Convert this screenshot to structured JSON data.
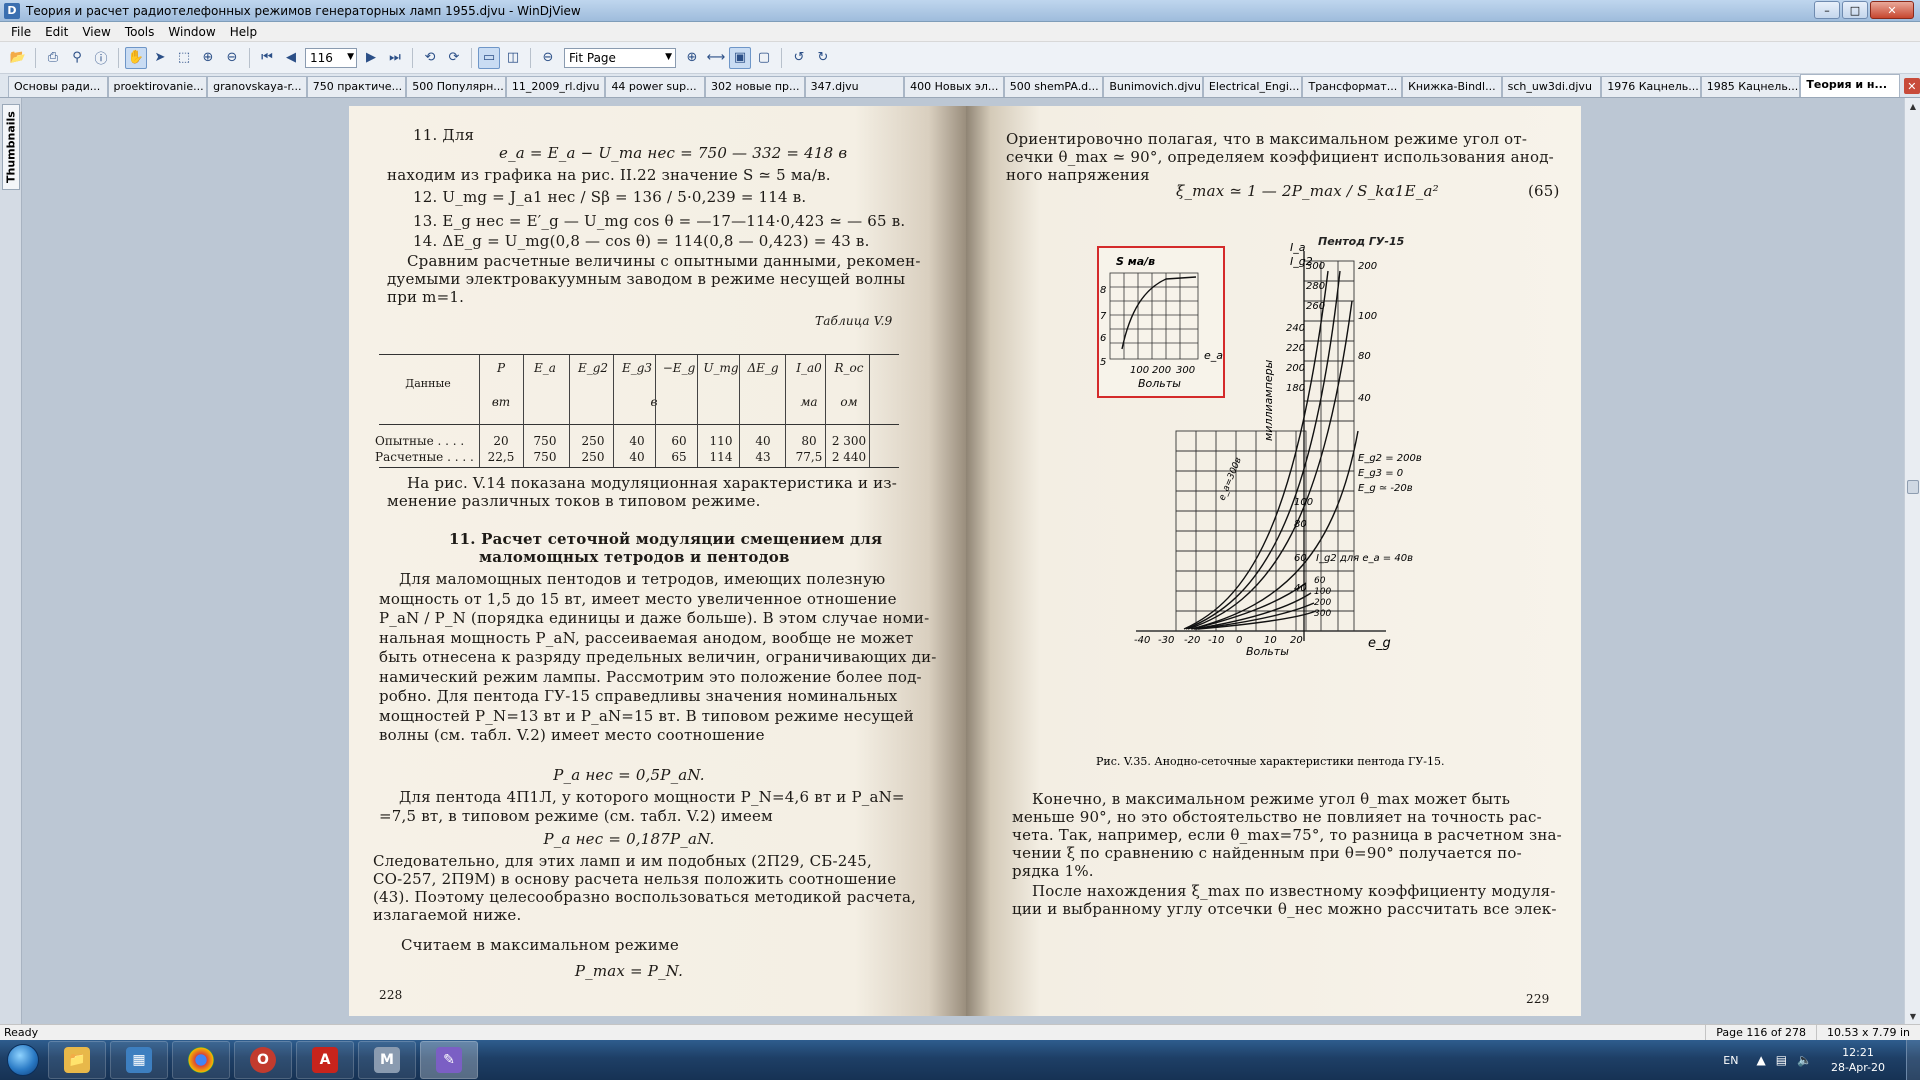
{
  "window": {
    "title": "Теория и расчет радиотелефонных режимов генераторных ламп 1955.djvu - WinDjView",
    "app_icon": "djvu-icon"
  },
  "menu": [
    "File",
    "Edit",
    "View",
    "Tools",
    "Window",
    "Help"
  ],
  "toolbar": {
    "page_number": "116",
    "zoom": "Fit Page"
  },
  "tabs": [
    {
      "label": "Основы ради..."
    },
    {
      "label": "proektirovanie..."
    },
    {
      "label": "granovskaya-r..."
    },
    {
      "label": "750 практиче..."
    },
    {
      "label": "500 Популярн..."
    },
    {
      "label": "11_2009_rl.djvu"
    },
    {
      "label": "44 power sup..."
    },
    {
      "label": "302 новые пр..."
    },
    {
      "label": "347.djvu"
    },
    {
      "label": "400 Новых эл..."
    },
    {
      "label": "500 shemPA.d..."
    },
    {
      "label": "Bunimovich.djvu"
    },
    {
      "label": "Electrical_Engi..."
    },
    {
      "label": "Трансформат..."
    },
    {
      "label": "Книжка-Bindl..."
    },
    {
      "label": "sch_uw3di.djvu"
    },
    {
      "label": "1976 Кацнель..."
    },
    {
      "label": "1985 Кацнель..."
    },
    {
      "label": "Теория и н...",
      "active": true
    }
  ],
  "sidebar": {
    "thumbnails_label": "Thumbnails"
  },
  "left_page": {
    "item11": "11. Для",
    "eq1": "e_a = E_a − U_ma нес = 750 — 332 = 418 в",
    "line_find": "находим из графика на рис. II.22 значение S ≃ 5 ма/в.",
    "item12": "12. U_mg = J_a1 нес / Sβ = 136 / 5·0,239 = 114 в.",
    "item13": "13. E_g нес = E′_g — U_mg cos θ = —17—114·0,423 ≃ — 65 в.",
    "item14": "14. ΔE_g = U_mg(0,8 — cos θ) = 114(0,8 — 0,423) = 43 в.",
    "p_compare_1": "Сравним расчетные величины с опытными данными, рекомен-",
    "p_compare_2": "дуемыми электровакуумным заводом в режиме несущей волны",
    "p_compare_3": "при m=1.",
    "table_caption": "Таблица V.9",
    "table": {
      "header_data": "Данные",
      "columns": [
        "P",
        "E_a",
        "E_g2",
        "E_g3",
        "−E_g",
        "U_mg",
        "ΔE_g",
        "I_a0",
        "R_oc"
      ],
      "units": [
        "вт",
        "в",
        "ма",
        "ом"
      ],
      "rows": [
        {
          "label": "Опытные . . . .",
          "values": [
            "20",
            "750",
            "250",
            "40",
            "60",
            "110",
            "40",
            "80",
            "2 300"
          ]
        },
        {
          "label": "Расчетные . . . .",
          "values": [
            "22,5",
            "750",
            "250",
            "40",
            "65",
            "114",
            "43",
            "77,5",
            "2 440"
          ]
        }
      ]
    },
    "p_fig_1": "На рис. V.14 показана модуляционная характеристика и из-",
    "p_fig_2": "менение различных токов в типовом режиме.",
    "section_title_1": "11. Расчет сеточной модуляции смещением для",
    "section_title_2": "маломощных тетродов и пентодов",
    "p1": [
      "Для маломощных пентодов и тетродов, имеющих полезную",
      "мощность от 1,5 до 15 вт, имеет место увеличенное отношение",
      "P_aN / P_N (порядка единицы и даже больше). В этом случае номи-",
      "нальная мощность P_aN, рассеиваемая анодом, вообще не может",
      "быть отнесена к разряду предельных величин, ограничивающих ди-",
      "намический режим лампы. Рассмотрим это положение более под-",
      "робно. Для пентода ГУ-15 справедливы значения номинальных",
      "мощностей P_N=13 вт и P_aN=15 вт. В типовом режиме несущей",
      "волны (см. табл. V.2) имеет место соотношение"
    ],
    "eq2": "P_a нес = 0,5P_aN.",
    "p2": [
      "Для пентода 4П1Л, у которого мощности P_N=4,6 вт и P_aN=",
      "=7,5 вт, в типовом режиме (см. табл. V.2) имеем"
    ],
    "eq3": "P_a нес = 0,187P_aN.",
    "p3": [
      "Следовательно, для этих ламп и им подобных (2П29, СБ-245,",
      "СО-257, 2П9М) в основу расчета нельзя положить соотношение",
      "(43). Поэтому целесообразно воспользоваться методикой расчета,",
      "излагаемой ниже."
    ],
    "p4": "Считаем в максимальном режиме",
    "eq4": "P_max = P_N.",
    "page_number": "228"
  },
  "right_page": {
    "p1": [
      "Ориентировочно полагая, что в максимальном режиме угол от-",
      "сечки θ_max ≃ 90°, определяем коэффициент использования анод-",
      "ного напряжения"
    ],
    "eq65": "ξ_max ≃ 1 — 2P_max / S_kα1E_a²",
    "eq65_num": "(65)",
    "figure": {
      "title": "Пентод ГУ-15",
      "inset_ylabel": "S ма/в",
      "inset_xlabel": "Вольты",
      "inset_ea": "e_a",
      "inset_yticks": [
        "8",
        "7",
        "6",
        "5"
      ],
      "inset_xticks": [
        "100",
        "200",
        "300"
      ],
      "ylabel_main": "миллиамперы",
      "la_label": "I_a",
      "lg2_label": "I_g2",
      "yticks_main": [
        "300",
        "280",
        "260",
        "240",
        "220",
        "200",
        "180",
        "100",
        "80",
        "60",
        "40"
      ],
      "yticks_right": [
        "200",
        "100",
        "80",
        "40"
      ],
      "legend": [
        "E_g2 = 200в",
        "E_g3 = 0",
        "E_g ≃ -20в"
      ],
      "ig2_note": "I_g2 для e_a = 40в",
      "curve_labels": [
        "e_a=300в",
        "60",
        "100",
        "200",
        "300"
      ],
      "xticks": [
        "-40",
        "-30",
        "-20",
        "-10",
        "0",
        "10",
        "20"
      ],
      "xlabel": "Вольты",
      "eg": "e_g",
      "caption": "Рис. V.35. Анодно-сеточные характеристики пентода ГУ-15.",
      "highlight_color": "#d42a2a"
    },
    "p2": [
      "Конечно, в максимальном режиме угол θ_max может быть",
      "меньше 90°, но это обстоятельство не повлияет на точность рас-",
      "чета. Так, например, если θ_max=75°, то разница в расчетном зна-",
      "чении ξ по сравнению с найденным при θ=90° получается по-",
      "рядка 1%."
    ],
    "p3": [
      "После нахождения ξ_max по известному коэффициенту модуля-",
      "ции и выбранному углу отсечки θ_нес можно рассчитать все элек-"
    ],
    "page_number": "229"
  },
  "status": {
    "ready": "Ready",
    "page": "Page 116 of 278",
    "size": "10.53 x 7.79 in"
  },
  "taskbar": {
    "apps": [
      "explorer-icon",
      "media-center-icon",
      "chrome-icon",
      "opera-icon",
      "acrobat-icon",
      "mathcad-icon",
      "winDjView-icon"
    ],
    "lang": "EN",
    "time": "12:21",
    "date": "28-Apr-20"
  }
}
